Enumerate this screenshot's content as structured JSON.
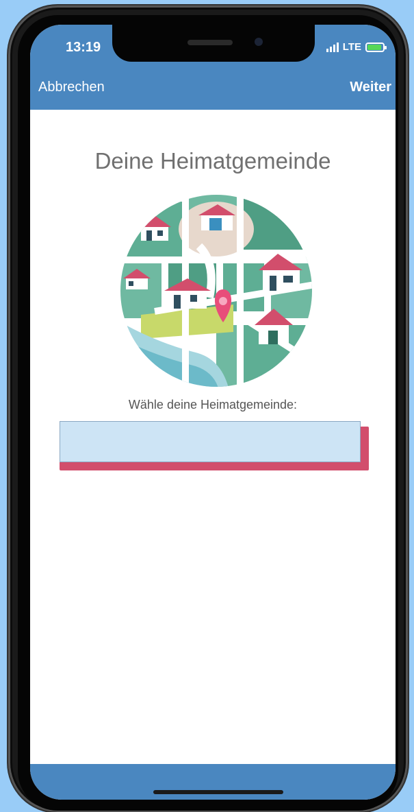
{
  "status_bar": {
    "time": "13:19",
    "network": "LTE"
  },
  "nav": {
    "cancel_label": "Abbrechen",
    "next_label": "Weiter"
  },
  "main": {
    "title": "Deine Heimatgemeinde",
    "field_label": "Wähle deine Heimatgemeinde:",
    "field_value": ""
  },
  "colors": {
    "background": "#99ccf7",
    "header_bar": "#4a87c0",
    "title_text": "#707070",
    "input_fill": "#cde4f5",
    "input_accent": "#d24e6c",
    "map_green": "#5eae94",
    "map_pin": "#e84d7a"
  },
  "icons": {
    "illustration": "village-map-with-location-pin",
    "signal": "signal-bars-icon",
    "battery": "battery-charging-icon"
  }
}
